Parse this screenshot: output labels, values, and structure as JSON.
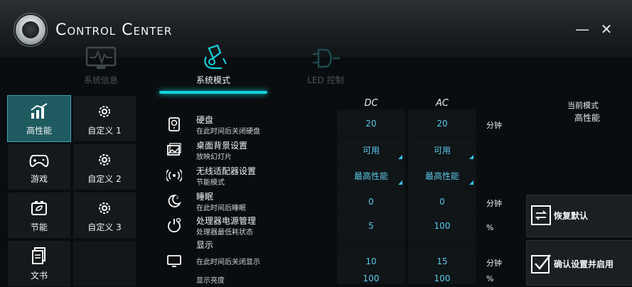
{
  "app": {
    "title": "Control Center"
  },
  "window": {
    "minimize": "—",
    "close": "✕"
  },
  "tabs": [
    {
      "label": "系统信息",
      "icon": "monitor-pulse-icon",
      "active": false
    },
    {
      "label": "系统模式",
      "icon": "mode-brush-icon",
      "active": true
    },
    {
      "label": "LED 控制",
      "icon": "led-bulb-icon",
      "active": false
    }
  ],
  "sidebar": {
    "items": [
      {
        "label": "高性能",
        "icon": "performance-chart-icon",
        "active": true
      },
      {
        "label": "自定义 1",
        "icon": "gear-icon"
      },
      {
        "label": "游戏",
        "icon": "gamepad-icon"
      },
      {
        "label": "自定义 2",
        "icon": "gear-icon"
      },
      {
        "label": "节能",
        "icon": "battery-eco-icon"
      },
      {
        "label": "自定义 3",
        "icon": "gear-icon"
      },
      {
        "label": "文书",
        "icon": "document-icon"
      }
    ]
  },
  "columns": {
    "dc": "DC",
    "ac": "AC"
  },
  "rows": [
    {
      "name": "硬盘",
      "sub": "在此时间后关闭硬盘",
      "dc": "20",
      "ac": "20",
      "unit": "分钟",
      "icon": "hard-disk-icon",
      "dropdown": false
    },
    {
      "name": "桌面背景设置",
      "sub": "放映幻灯片",
      "dc": "可用",
      "ac": "可用",
      "unit": "",
      "icon": "wallpaper-icon",
      "dropdown": true
    },
    {
      "name": "无线适配器设置",
      "sub": "节能模式",
      "dc": "最高性能",
      "ac": "最高性能",
      "unit": "",
      "icon": "wireless-icon",
      "dropdown": true
    },
    {
      "name": "睡眠",
      "sub": "在此时间后睡眠",
      "dc": "0",
      "ac": "0",
      "unit": "分钟",
      "icon": "sleep-icon",
      "dropdown": false
    },
    {
      "name": "处理器电源管理",
      "sub": "处理器最低耗状态",
      "dc": "5",
      "ac": "100",
      "unit": "%",
      "icon": "cpu-power-icon",
      "dropdown": false
    },
    {
      "name": "显示",
      "sub": "",
      "dc": "",
      "ac": "",
      "unit": "",
      "icon": "",
      "dropdown": false
    },
    {
      "name": "",
      "sub": "在此时间后关闭显示",
      "dc": "10",
      "ac": "15",
      "unit": "分钟",
      "icon": "display-icon",
      "dropdown": false
    },
    {
      "name": "",
      "sub": "显示亮度",
      "dc": "100",
      "ac": "100",
      "unit": "%",
      "icon": "",
      "dropdown": false
    }
  ],
  "current_mode": {
    "title": "当前模式",
    "value": "高性能"
  },
  "actions": {
    "restore": "恢复默认",
    "confirm": "确认设置并启用"
  },
  "colors": {
    "accent": "#14d2dc",
    "active_tile": "#1f5a60",
    "value_text": "#5cc9e8"
  }
}
